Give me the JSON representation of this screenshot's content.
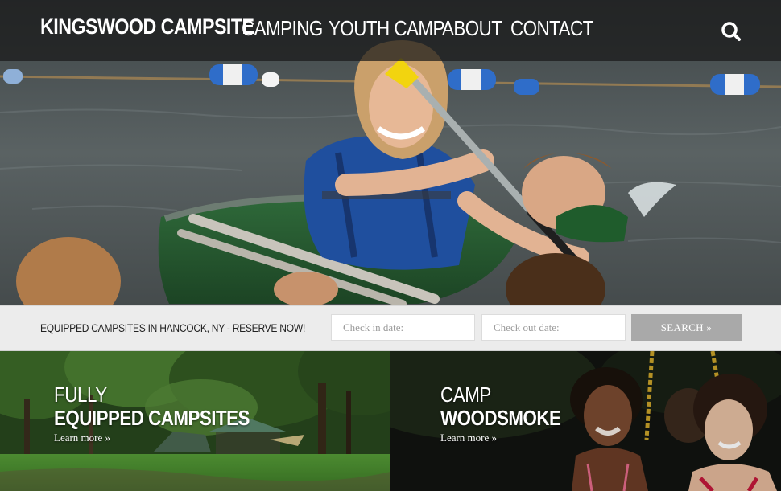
{
  "nav": {
    "logo": "KINGSWOOD CAMPSITE",
    "items": [
      {
        "label": "CAMPING"
      },
      {
        "label": "YOUTH CAMP"
      },
      {
        "label": "ABOUT"
      },
      {
        "label": "CONTACT"
      }
    ],
    "search_icon": "search-icon"
  },
  "hero": {
    "image": "girl-paddling-canoe-photo"
  },
  "reserve": {
    "tagline": "EQUIPPED CAMPSITES IN HANCOCK, NY - RESERVE NOW!",
    "checkin_placeholder": "Check in date:",
    "checkout_placeholder": "Check out date:",
    "checkin_value": "",
    "checkout_value": "",
    "search_label": "SEARCH »"
  },
  "tiles": [
    {
      "line1": "FULLY",
      "line2": "EQUIPPED CAMPSITES",
      "link": "Learn more »",
      "image": "campsite-meadow-photo"
    },
    {
      "line1": "CAMP",
      "line2": "WOODSMOKE",
      "link": "Learn more »",
      "image": "girls-on-swing-photo"
    }
  ],
  "colors": {
    "nav_bg": "#191919",
    "reserve_bg": "#ececec",
    "search_button": "#a9a9a9",
    "text_light": "#ffffff",
    "text_dark": "#222222"
  }
}
